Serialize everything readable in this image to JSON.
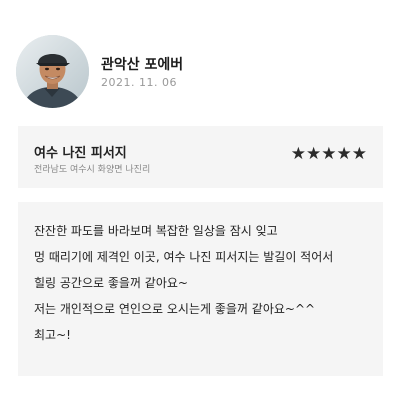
{
  "author": {
    "name": "관악산 포에버",
    "date": "2021. 11. 06"
  },
  "place": {
    "name": "여수 나진 피서지",
    "address": "전라남도 여수시 화양면 나진리",
    "rating_stars": "★★★★★",
    "rating_value": 5,
    "rating_max": 5
  },
  "review": {
    "lines": [
      "잔잔한 파도를 바라보며 복잡한 일상을 잠시 잊고",
      "멍 때리기에 제격인 이곳, 여수  나진 피서지는 발길이 적어서",
      "힐링 공간으로 좋을꺼 같아요~",
      "저는 개인적으로 연인으로 오시는게 좋을꺼 같아요~^^",
      "최고~!"
    ]
  }
}
